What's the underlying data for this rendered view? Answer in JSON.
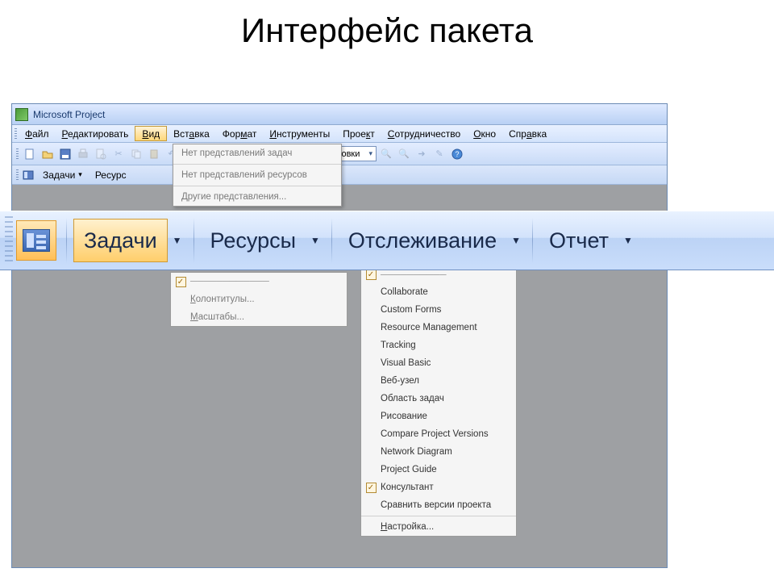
{
  "slide": {
    "title": "Интерфейс пакета"
  },
  "titlebar": {
    "app_name": "Microsoft Project"
  },
  "menubar": {
    "items": [
      {
        "pre": "",
        "u": "Ф",
        "post": "айл"
      },
      {
        "pre": "",
        "u": "Р",
        "post": "едактировать"
      },
      {
        "pre": "",
        "u": "В",
        "post": "ид"
      },
      {
        "pre": "Вст",
        "u": "а",
        "post": "вка"
      },
      {
        "pre": "Фор",
        "u": "м",
        "post": "ат"
      },
      {
        "pre": "",
        "u": "И",
        "post": "нструменты"
      },
      {
        "pre": "Прое",
        "u": "к",
        "post": "т"
      },
      {
        "pre": "",
        "u": "С",
        "post": "отрудничество"
      },
      {
        "pre": "",
        "u": "О",
        "post": "кно"
      },
      {
        "pre": "Спр",
        "u": "а",
        "post": "вка"
      }
    ]
  },
  "toolbar": {
    "group_label": "Нет группировки"
  },
  "small_taskbar": {
    "tasks": "Задачи",
    "resources": "Ресурс"
  },
  "view_dropdown": {
    "items": [
      "Нет представлений задач",
      "Нет представлений ресурсов",
      "Другие представления..."
    ]
  },
  "left_menu": {
    "items": [
      {
        "label_pre": "",
        "label_u": "К",
        "label_post": "олонтитулы...",
        "check": false
      },
      {
        "label_pre": "",
        "label_u": "М",
        "label_post": "асштабы...",
        "check": false
      }
    ],
    "header_row": {
      "label": "",
      "check": true
    }
  },
  "right_menu": {
    "items": [
      {
        "label": "Collaborate",
        "check": false
      },
      {
        "label": "Custom Forms",
        "check": false
      },
      {
        "label": "Resource Management",
        "check": false
      },
      {
        "label": "Tracking",
        "check": false
      },
      {
        "label": "Visual Basic",
        "check": false
      },
      {
        "label": "Веб-узел",
        "check": false
      },
      {
        "label": "Область задач",
        "check": false
      },
      {
        "label": "Рисование",
        "check": false
      },
      {
        "label": "Compare Project Versions",
        "check": false
      },
      {
        "label": "Network Diagram",
        "check": false
      },
      {
        "label": "Project Guide",
        "check": false
      },
      {
        "label": "Консультант",
        "check": true
      },
      {
        "label": "Сравнить версии проекта",
        "check": false
      }
    ],
    "footer_pre": "",
    "footer_u": "Н",
    "footer_post": "астройка..."
  },
  "bigbar": {
    "tasks": "Задачи",
    "resources": "Ресурсы",
    "tracking": "Отслеживание",
    "report": "Отчет"
  }
}
